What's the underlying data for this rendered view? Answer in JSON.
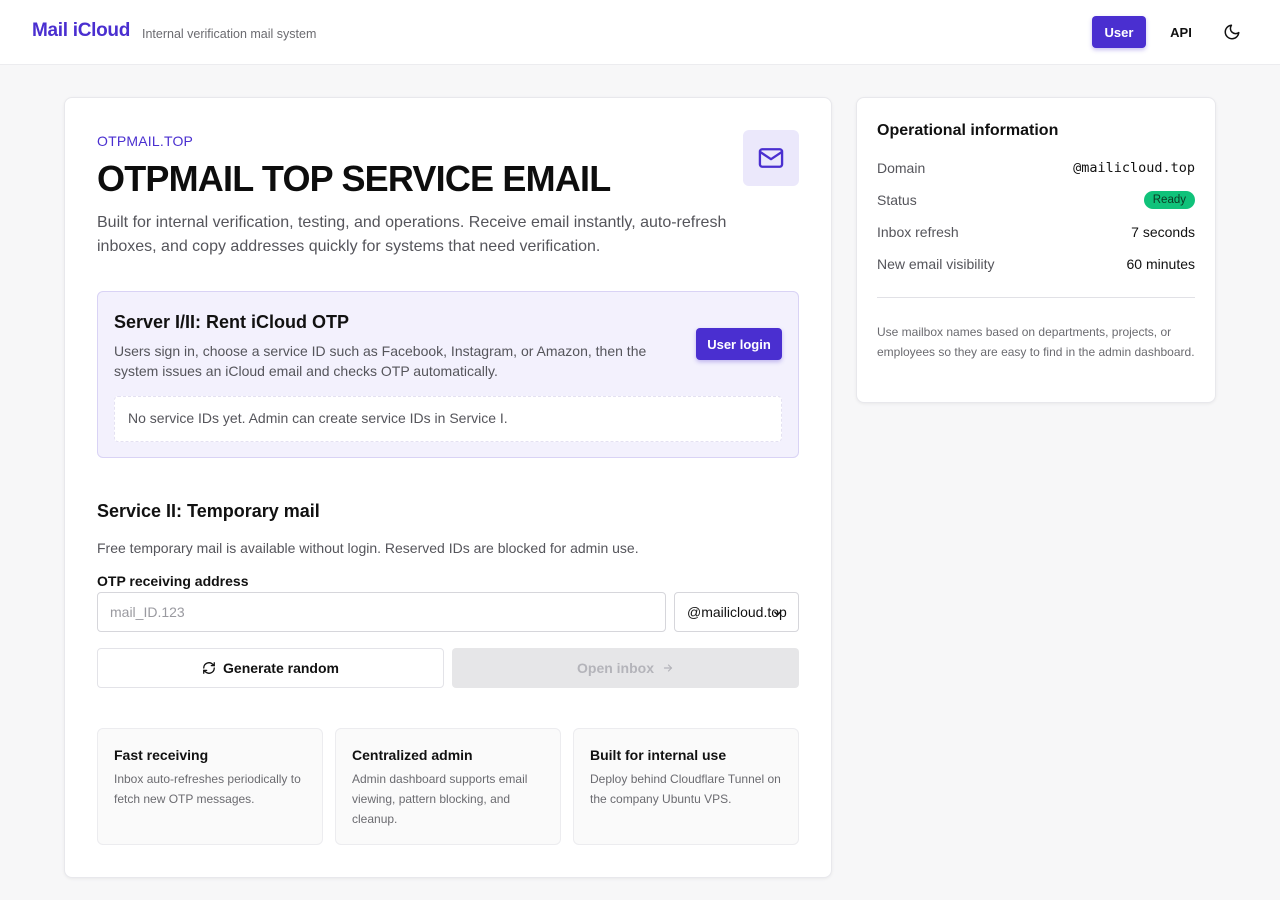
{
  "header": {
    "brand": "Mail iCloud",
    "tagline": "Internal verification mail system",
    "user_label": "User",
    "api_label": "API",
    "theme_icon": "moon-icon"
  },
  "hero": {
    "eyebrow": "OTPMAIL.TOP",
    "title": "OTPMAIL TOP SERVICE EMAIL",
    "description": "Built for internal verification, testing, and operations. Receive email instantly, auto-refresh inboxes, and copy addresses quickly for systems that need verification.",
    "icon": "mail-icon"
  },
  "server": {
    "title": "Server I/II: Rent iCloud OTP",
    "description": "Users sign in, choose a service ID such as Facebook, Instagram, or Amazon, then the system issues an iCloud email and checks OTP automatically.",
    "login_label": "User login",
    "empty_text": "No service IDs yet. Admin can create service IDs in Service I."
  },
  "temp_mail": {
    "title": "Service II: Temporary mail",
    "description": "Free temporary mail is available without login. Reserved IDs are blocked for admin use.",
    "address_label": "OTP receiving address",
    "input_value": "",
    "input_placeholder": "mail_ID.123",
    "domain_selected": "@mailicloud.top",
    "generate_label": "Generate random",
    "open_label": "Open inbox"
  },
  "features": [
    {
      "title": "Fast receiving",
      "description": "Inbox auto-refreshes periodically to fetch new OTP messages."
    },
    {
      "title": "Centralized admin",
      "description": "Admin dashboard supports email viewing, pattern blocking, and cleanup."
    },
    {
      "title": "Built for internal use",
      "description": "Deploy behind Cloudflare Tunnel on the company Ubuntu VPS."
    }
  ],
  "operational": {
    "title": "Operational information",
    "rows": [
      {
        "key": "Domain",
        "value": "@mailicloud.top"
      },
      {
        "key": "Status",
        "value": "Ready"
      },
      {
        "key": "Inbox refresh",
        "value": "7 seconds"
      },
      {
        "key": "New email visibility",
        "value": "60 minutes"
      }
    ],
    "note": "Use mailbox names based on departments, projects, or employees so they are easy to find in the admin dashboard."
  },
  "colors": {
    "accent": "#4a2fd0",
    "status_ready": "#10c27a",
    "background": "#f7f7f8"
  }
}
